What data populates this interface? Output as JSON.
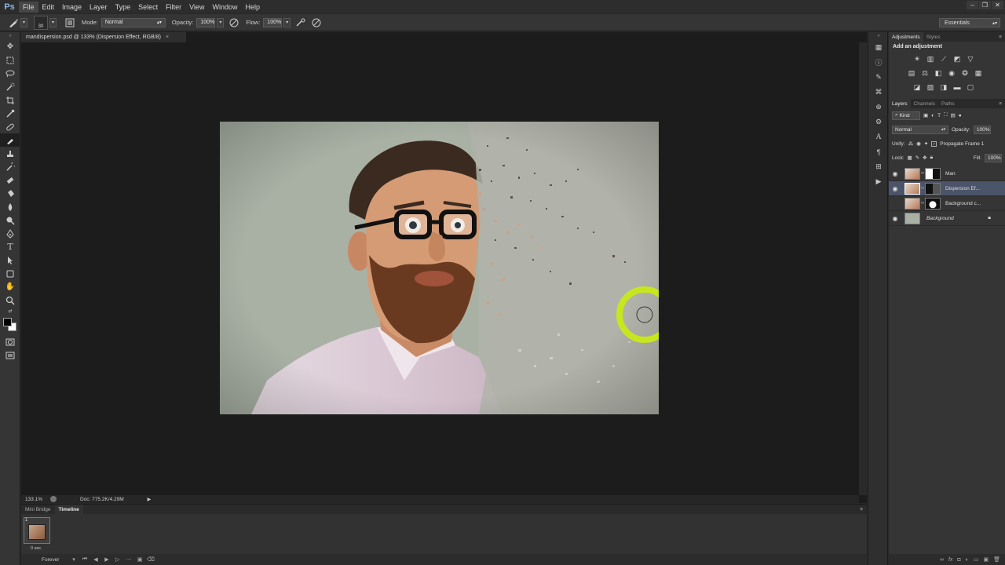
{
  "app": {
    "logo": "Ps"
  },
  "menu": [
    "File",
    "Edit",
    "Image",
    "Layer",
    "Type",
    "Select",
    "Filter",
    "View",
    "Window",
    "Help"
  ],
  "window_controls": [
    "–",
    "❐",
    "✕"
  ],
  "options": {
    "brush_size": "30",
    "mode_label": "Mode:",
    "mode_value": "Normal",
    "opacity_label": "Opacity:",
    "opacity_value": "100%",
    "flow_label": "Flow:",
    "flow_value": "100%",
    "workspace": "Essentials"
  },
  "document": {
    "tab_title": "mandispersion.psd @ 133% (Dispersion Effect, RGB/8)",
    "tab_close": "×",
    "zoom": "133.1%",
    "doc_info": "Doc: 775.2K/4.29M"
  },
  "timeline": {
    "tabs": [
      "Mini Bridge",
      "Timeline"
    ],
    "frame_number": "1",
    "frame_delay": "0 sec.",
    "loop": "Forever"
  },
  "adjustments": {
    "tabs": [
      "Adjustments",
      "Styles"
    ],
    "title": "Add an adjustment"
  },
  "layers_panel": {
    "tabs": [
      "Layers",
      "Channels",
      "Paths"
    ],
    "filter_kind": "Kind",
    "blend_mode": "Normal",
    "opacity_label": "Opacity:",
    "opacity_value": "100%",
    "unify_label": "Unify:",
    "propagate_label": "Propagate Frame 1",
    "lock_label": "Lock:",
    "fill_label": "Fill:",
    "fill_value": "100%",
    "layers": [
      {
        "name": "Man",
        "visible": true,
        "selected": false
      },
      {
        "name": "Dispersion Ef...",
        "visible": true,
        "selected": true
      },
      {
        "name": "Background c...",
        "visible": false,
        "selected": false
      },
      {
        "name": "Background",
        "visible": true,
        "selected": false
      }
    ]
  },
  "colors": {
    "accent_cursor": "#c8e61e",
    "selected_layer": "#4b5468"
  }
}
